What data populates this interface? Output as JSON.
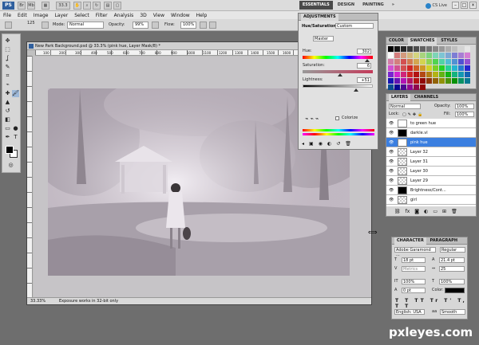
{
  "app": {
    "logo": "PS",
    "zoom_label": "33.3",
    "workspaces": [
      "ESSENTIALS",
      "DESIGN",
      "PAINTING",
      "»"
    ],
    "cs_live": "CS Live",
    "window_controls": [
      "–",
      "□",
      "×"
    ]
  },
  "menu": [
    "File",
    "Edit",
    "Image",
    "Layer",
    "Select",
    "Filter",
    "Analysis",
    "3D",
    "View",
    "Window",
    "Help"
  ],
  "options": {
    "brush_size": "125",
    "mode_label": "Mode:",
    "mode_value": "Normal",
    "opacity_label": "Opacity:",
    "opacity_value": "99%",
    "flow_label": "Flow:",
    "flow_value": "100%"
  },
  "document": {
    "title": "New Park Background.psd @ 33.3% (pink hue, Layer Mask/8) *",
    "ruler_marks": [
      "100",
      "200",
      "300",
      "400",
      "500",
      "600",
      "700",
      "800",
      "900",
      "1000",
      "1100",
      "1200",
      "1300",
      "1400",
      "1500",
      "1600",
      "1700",
      "1800",
      "1900",
      "2000"
    ],
    "zoom": "33.33%",
    "status": "Exposure works in 32-bit only"
  },
  "adjustments": {
    "tab": "ADJUSTMENTS",
    "type": "Hue/Saturation",
    "preset": "Custom",
    "channel": "Master",
    "hue_label": "Hue:",
    "hue_value": "302",
    "hue_fraction": 0.92,
    "saturation_label": "Saturation:",
    "saturation_value": "6",
    "saturation_fraction": 0.53,
    "lightness_label": "Lightness:",
    "lightness_value": "+51",
    "lightness_fraction": 0.75,
    "colorize_label": "Colorize"
  },
  "swatches": {
    "tabs": [
      "COLOR",
      "SWATCHES",
      "STYLES"
    ]
  },
  "layers": {
    "tabs": [
      "LAYERS",
      "CHANNELS"
    ],
    "blend_mode": "Normal",
    "opacity_label": "Opacity:",
    "opacity_value": "100%",
    "lock_label": "Lock:",
    "fill_label": "Fill:",
    "fill_value": "100%",
    "items": [
      {
        "name": "to green hue",
        "selected": false
      },
      {
        "name": "darkle.vl",
        "selected": false
      },
      {
        "name": "pink hue",
        "selected": true
      },
      {
        "name": "Layer 32",
        "selected": false
      },
      {
        "name": "Layer 31",
        "selected": false
      },
      {
        "name": "Layer 30",
        "selected": false
      },
      {
        "name": "Layer 29",
        "selected": false
      },
      {
        "name": "Brightness/Cont...",
        "selected": false
      },
      {
        "name": "girl",
        "selected": false
      }
    ]
  },
  "character": {
    "tabs": [
      "CHARACTER",
      "PARAGRAPH"
    ],
    "font_family": "Adobe Garamond ...",
    "font_style": "Regular",
    "font_size": "18 pt",
    "leading": "21.4 pt",
    "kerning": "Metrics",
    "tracking": "25",
    "vscale": "100%",
    "hscale": "100%",
    "baseline": "0 pt",
    "color_label": "Color:",
    "language": "English: USA",
    "antialias": "Smooth"
  },
  "watermark": "pxleyes.com"
}
